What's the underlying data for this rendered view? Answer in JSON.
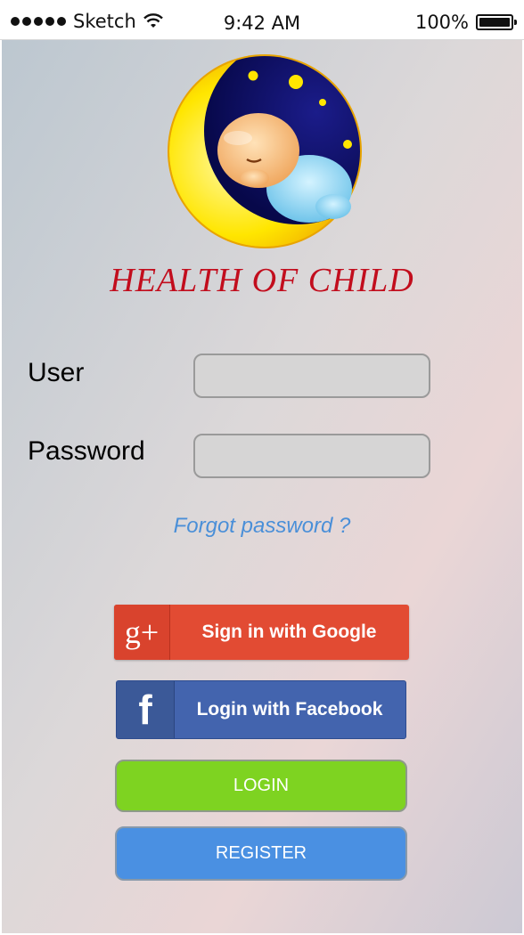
{
  "status_bar": {
    "carrier": "Sketch",
    "time": "9:42 AM",
    "battery": "100%"
  },
  "app": {
    "brand_title": "HEALTH OF CHILD",
    "logo_icon": "moon-sleeping-baby-icon"
  },
  "form": {
    "user_label": "User",
    "user_value": "",
    "password_label": "Password",
    "password_value": "",
    "forgot_password": "Forgot password ?"
  },
  "buttons": {
    "google": "Sign in with Google",
    "google_icon_text": "g+",
    "facebook": "Login with Facebook",
    "facebook_icon_text": "f",
    "login": "LOGIN",
    "register": "REGISTER"
  },
  "colors": {
    "brand": "#c20d1d",
    "link": "#4a8fd8",
    "google": "#e24b33",
    "facebook": "#4364ae",
    "login": "#7ed321",
    "register": "#4a90e2"
  }
}
